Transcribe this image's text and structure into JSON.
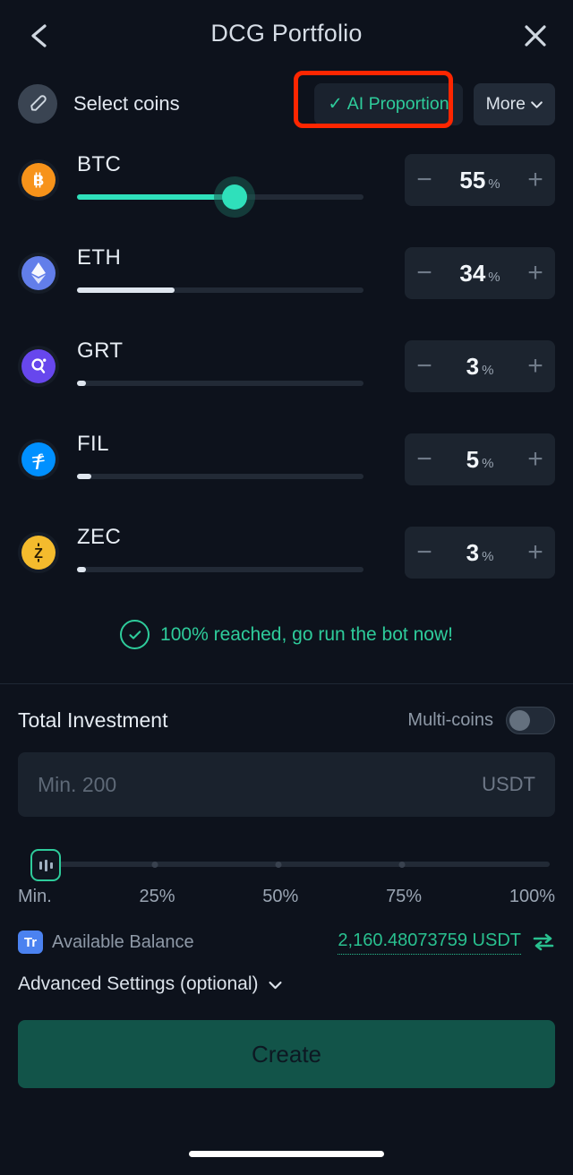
{
  "header": {
    "title": "DCG Portfolio",
    "back_icon": "chevron-left-icon",
    "close_icon": "close-icon"
  },
  "toolbar": {
    "edit_icon": "pencil-icon",
    "select_label": "Select coins",
    "ai_proportion_label": "AI Proportion",
    "ai_proportion_check": "✓",
    "ai_proportion_active": true,
    "more_label": "More",
    "more_chevron": "chevron-down-icon",
    "highlight_color": "#fe2600"
  },
  "coins": [
    {
      "symbol": "BTC",
      "icon": "bitcoin-icon",
      "glyph": "₿",
      "icon_color": "#f7931a",
      "icon_text_color": "#ffffff",
      "percent": 55,
      "unit": "%",
      "slider_fill_color": "#2fe0bb",
      "has_thumb": true,
      "minus": "−",
      "plus": "+"
    },
    {
      "symbol": "ETH",
      "icon": "ethereum-icon",
      "glyph": "♦",
      "icon_color": "#627eea",
      "icon_text_color": "#ffffff",
      "percent": 34,
      "unit": "%",
      "slider_fill_color": "#dfe6ef",
      "has_thumb": false,
      "minus": "−",
      "plus": "+"
    },
    {
      "symbol": "GRT",
      "icon": "the-graph-icon",
      "glyph": "○",
      "icon_color": "#6747ed",
      "icon_text_color": "#ffffff",
      "percent": 3,
      "unit": "%",
      "slider_fill_color": "#dfe6ef",
      "has_thumb": false,
      "minus": "−",
      "plus": "+"
    },
    {
      "symbol": "FIL",
      "icon": "filecoin-icon",
      "glyph": "ƒ",
      "icon_color": "#0090ff",
      "icon_text_color": "#ffffff",
      "percent": 5,
      "unit": "%",
      "slider_fill_color": "#dfe6ef",
      "has_thumb": false,
      "minus": "−",
      "plus": "+"
    },
    {
      "symbol": "ZEC",
      "icon": "zcash-icon",
      "glyph": "Z",
      "icon_color": "#f4bb2d",
      "icon_text_color": "#2a1f05",
      "percent": 3,
      "unit": "%",
      "slider_fill_color": "#dfe6ef",
      "has_thumb": false,
      "minus": "−",
      "plus": "+"
    }
  ],
  "status": {
    "icon": "check-circle-icon",
    "message": "100% reached, go run the bot now!",
    "color": "#2ecc9b"
  },
  "investment": {
    "title": "Total Investment",
    "multi_coins_label": "Multi-coins",
    "multi_coins_on": false,
    "amount_value": "",
    "amount_placeholder": "Min. 200",
    "currency": "USDT",
    "slider_thumb_icon": "bars-icon",
    "slider_labels": [
      "Min.",
      "25%",
      "50%",
      "75%",
      "100%"
    ],
    "slider_position_percent": 0
  },
  "balance": {
    "badge": "Tr",
    "label": "Available Balance",
    "value": "2,160.48073759 USDT",
    "swap_icon": "swap-icon",
    "value_color": "#29c08f"
  },
  "advanced": {
    "label": "Advanced Settings (optional)",
    "chevron": "chevron-down-icon"
  },
  "primary_action": {
    "label": "Create",
    "color": "#125449"
  }
}
